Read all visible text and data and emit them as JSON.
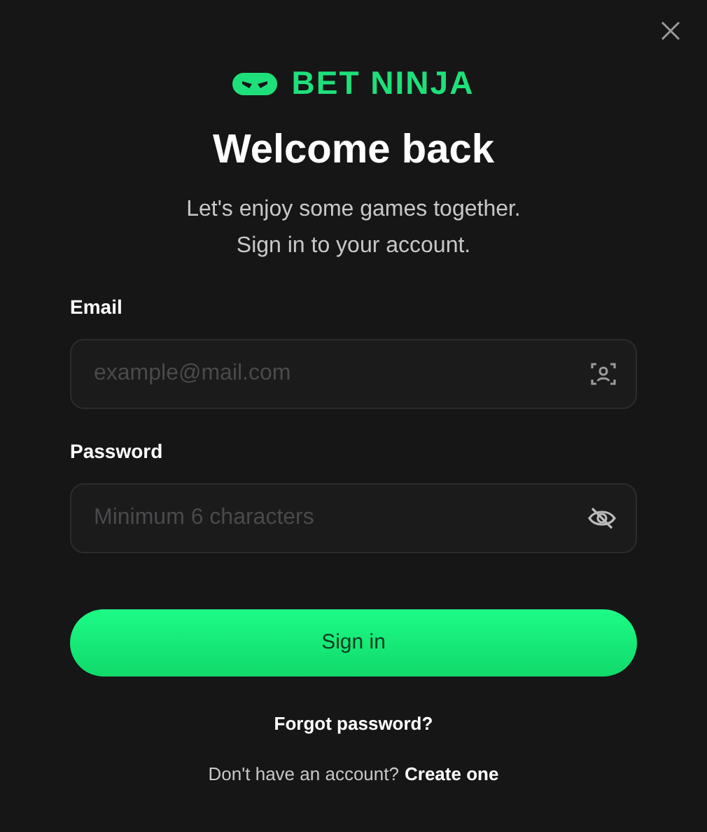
{
  "brand": "BET NINJA",
  "title": "Welcome back",
  "subtitle": [
    "Let's enjoy some games together.",
    "Sign in to your account."
  ],
  "fields": [
    {
      "label": "Email",
      "placeholder": "example@mail.com",
      "kind": "email"
    },
    {
      "label": "Password",
      "placeholder": "Minimum 6 characters",
      "kind": "password"
    }
  ],
  "submit": "Sign in",
  "forgot": "Forgot password?",
  "signup": {
    "text": "Don't have an account?",
    "link": "Create one"
  }
}
